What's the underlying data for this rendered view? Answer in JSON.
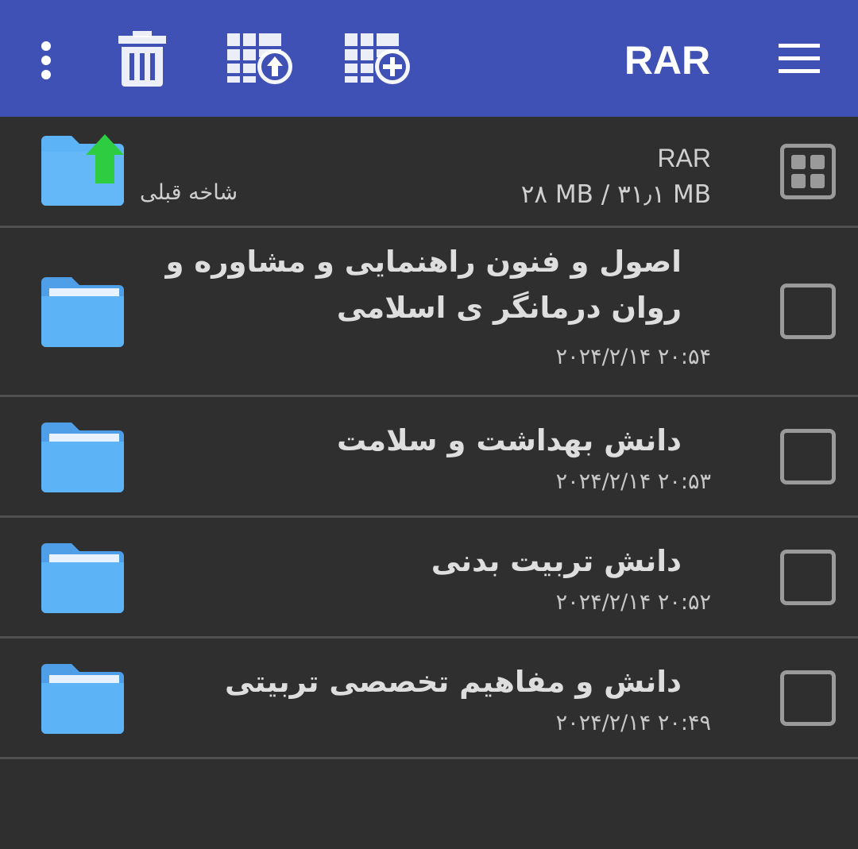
{
  "toolbar": {
    "title": "RAR",
    "icons": [
      "more-vert-icon",
      "trash-icon",
      "extract-archive-icon",
      "add-to-archive-icon",
      "hamburger-menu-icon"
    ]
  },
  "parent": {
    "archive_type": "RAR",
    "size_info": "۲۸ MB / ۳۱٫۱ MB",
    "label": "شاخه قبلی"
  },
  "items": [
    {
      "name": "اصول و فنون راهنمایی و مشاوره و روان درمانگر ی اسلامی",
      "date": "۲۰:۵۴ ۲۰۲۴/۲/۱۴"
    },
    {
      "name": "دانش بهداشت و سلامت",
      "date": "۲۰:۵۳ ۲۰۲۴/۲/۱۴"
    },
    {
      "name": "دانش تربیت بدنی",
      "date": "۲۰:۵۲ ۲۰۲۴/۲/۱۴"
    },
    {
      "name": "دانش و مفاهیم تخصصی تربیتی",
      "date": "۲۰:۴۹ ۲۰۲۴/۲/۱۴"
    }
  ],
  "colors": {
    "toolbar_bg": "#3f51b5",
    "list_bg": "#2f2f2f",
    "folder_blue": "#5cb3f6",
    "up_arrow_green": "#2ecc40"
  }
}
